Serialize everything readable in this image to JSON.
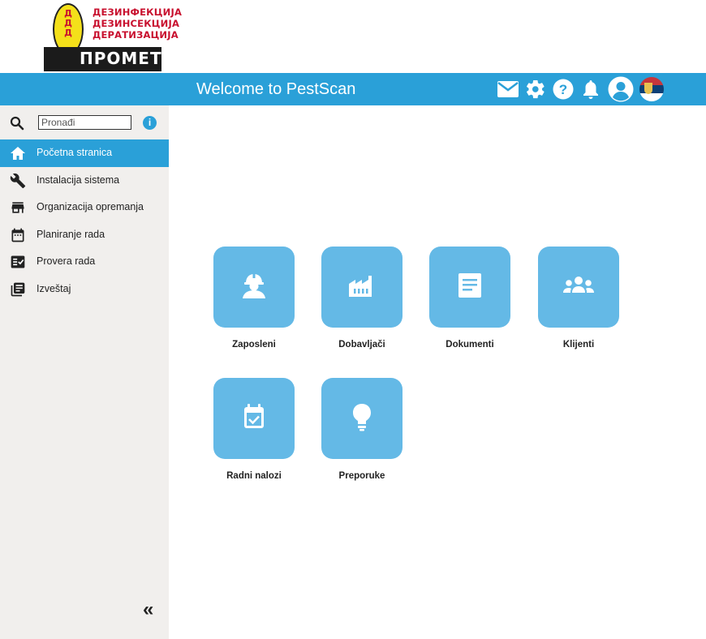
{
  "logo": {
    "oval_letters": [
      "Д",
      "Д",
      "Д"
    ],
    "lines": [
      "ДЕЗИНФЕКЦИЈА",
      "ДЕЗИНСЕКЦИЈА",
      "ДЕРАТИЗАЦИЈА"
    ],
    "bar_text": "ПРОМЕТ"
  },
  "header": {
    "title": "Welcome to PestScan",
    "icons": [
      "mail-icon",
      "gear-icon",
      "help-icon",
      "bell-icon",
      "user-icon",
      "serbia-flag-icon"
    ]
  },
  "sidebar": {
    "search": {
      "placeholder": "Pronađi",
      "value": ""
    },
    "items": [
      {
        "label": "Početna stranica",
        "icon": "home-icon",
        "active": true
      },
      {
        "label": "Instalacija sistema",
        "icon": "wrench-icon",
        "active": false
      },
      {
        "label": "Organizacija opremanja",
        "icon": "store-icon",
        "active": false
      },
      {
        "label": "Planiranje rada",
        "icon": "calendar-icon",
        "active": false
      },
      {
        "label": "Provera rada",
        "icon": "checklist-icon",
        "active": false
      },
      {
        "label": "Izveštaj",
        "icon": "report-icon",
        "active": false
      }
    ],
    "collapse_label": "«"
  },
  "tiles": [
    {
      "label": "Zaposleni",
      "icon": "worker-icon"
    },
    {
      "label": "Dobavljači",
      "icon": "factory-icon"
    },
    {
      "label": "Dokumenti",
      "icon": "document-icon"
    },
    {
      "label": "Klijenti",
      "icon": "group-icon"
    },
    {
      "label": "Radni nalozi",
      "icon": "calendar-check-icon"
    },
    {
      "label": "Preporuke",
      "icon": "lightbulb-icon"
    }
  ],
  "colors": {
    "primary": "#2aa0d8",
    "tile": "#64b9e6",
    "sidebar_bg": "#f1efed"
  }
}
